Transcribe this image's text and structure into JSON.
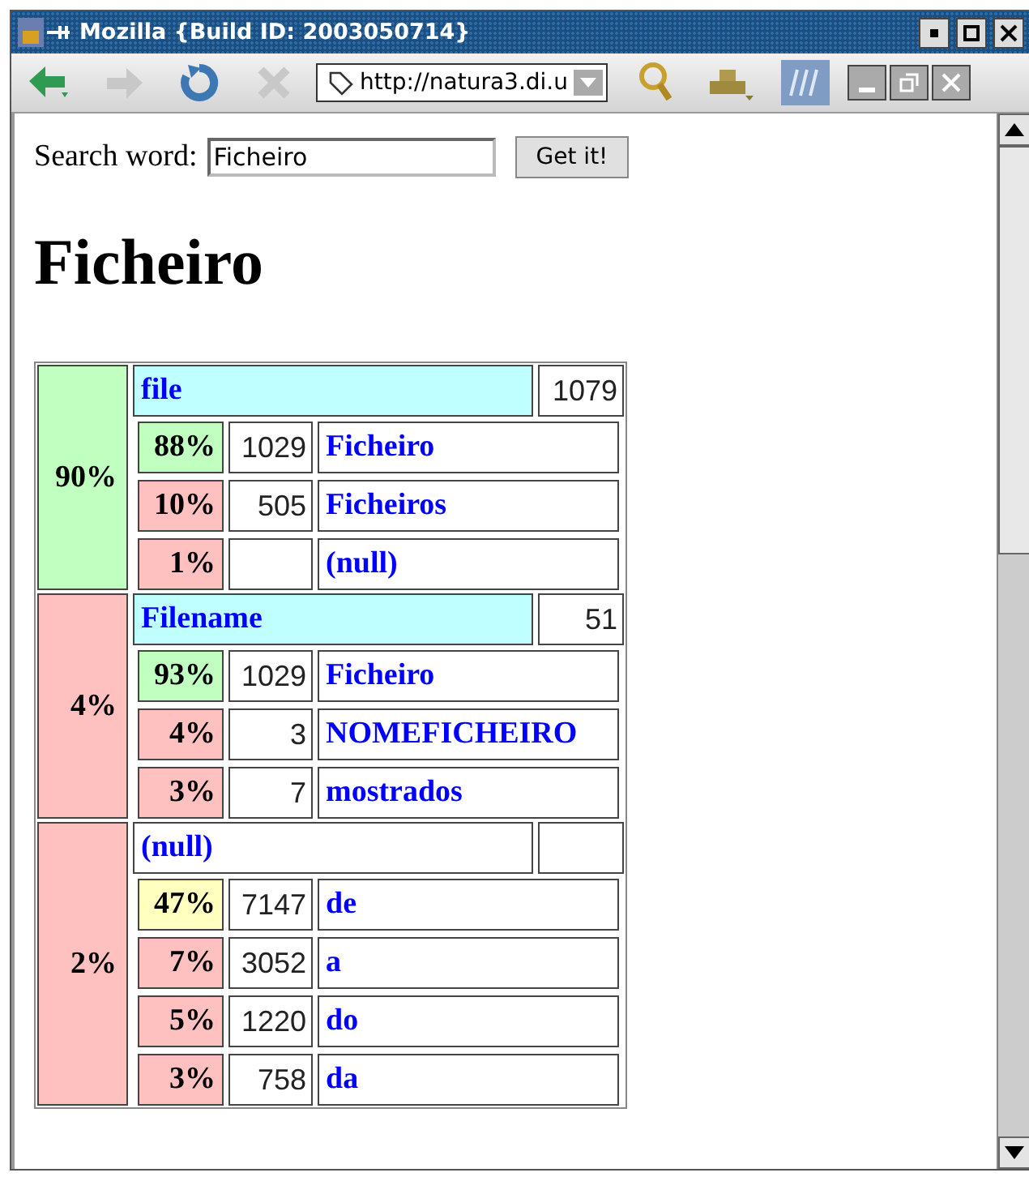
{
  "window": {
    "title": "Mozilla {Build ID: 2003050714}"
  },
  "toolbar": {
    "url": "http://natura3.di.u",
    "back_disabled": false,
    "forward_disabled": true,
    "stop_disabled": true
  },
  "search": {
    "label": "Search word:",
    "value": "Ficheiro",
    "button": "Get it!"
  },
  "heading": "Ficheiro",
  "groups": [
    {
      "percent": "90%",
      "color": "#c0ffc0",
      "header": {
        "word": "file",
        "color": "#c0ffff",
        "count": "1079"
      },
      "rows": [
        {
          "percent": "88%",
          "color": "#c0ffc0",
          "count": "1029",
          "word": "Ficheiro"
        },
        {
          "percent": "10%",
          "color": "#ffc0c0",
          "count": "505",
          "word": "Ficheiros"
        },
        {
          "percent": "1%",
          "color": "#ffc0c0",
          "word": "(null)"
        }
      ]
    },
    {
      "percent": "4%",
      "color": "#ffc0c0",
      "header": {
        "word": "Filename",
        "color": "#c0ffff",
        "count": "51"
      },
      "rows": [
        {
          "percent": "93%",
          "color": "#c0ffc0",
          "count": "1029",
          "word": "Ficheiro"
        },
        {
          "percent": "4%",
          "color": "#ffc0c0",
          "count": "3",
          "word": "NOMEFICHEIRO"
        },
        {
          "percent": "3%",
          "color": "#ffc0c0",
          "count": "7",
          "word": "mostrados"
        }
      ]
    },
    {
      "percent": "2%",
      "color": "#ffc0c0",
      "header": {
        "word": "(null)",
        "color": "#ffffff"
      },
      "rows": [
        {
          "percent": "47%",
          "color": "#ffffc0",
          "count": "7147",
          "word": "de"
        },
        {
          "percent": "7%",
          "color": "#ffc0c0",
          "count": "3052",
          "word": "a"
        },
        {
          "percent": "5%",
          "color": "#ffc0c0",
          "count": "1220",
          "word": "do"
        },
        {
          "percent": "3%",
          "color": "#ffc0c0",
          "count": "758",
          "word": "da"
        }
      ]
    }
  ]
}
